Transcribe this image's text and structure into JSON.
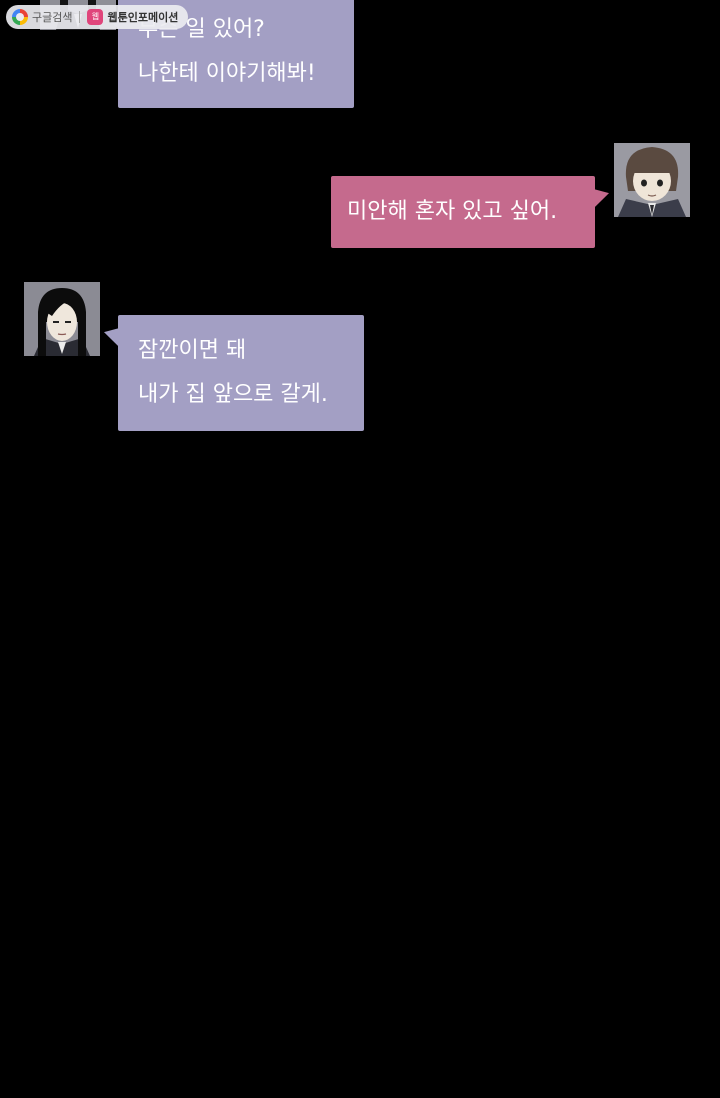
{
  "badge": {
    "search_label": "구글검색",
    "brand_icon_label": "웹",
    "brand_label": "웹툰인포메이션"
  },
  "messages": [
    {
      "side": "left",
      "lines": [
        "무슨 일 있어?",
        "나한테 이야기해봐!"
      ]
    },
    {
      "side": "right",
      "lines": [
        "미안해 혼자 있고 싶어."
      ]
    },
    {
      "side": "left",
      "lines": [
        "잠깐이면 돼",
        "내가 집 앞으로 갈게."
      ]
    }
  ],
  "colors": {
    "background": "#000000",
    "left_bubble": "#a39fc4",
    "right_bubble": "#c56a8d",
    "text": "#ffffff"
  }
}
